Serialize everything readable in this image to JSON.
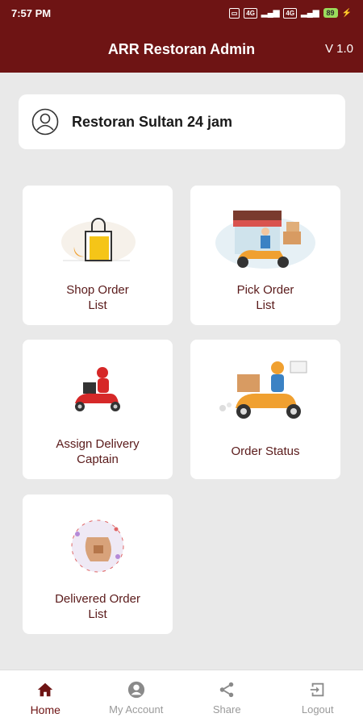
{
  "status_bar": {
    "time": "7:57 PM",
    "battery": "89"
  },
  "app_bar": {
    "title": "ARR Restoran Admin",
    "version": "V 1.0"
  },
  "restaurant": {
    "name": "Restoran Sultan 24 jam",
    "icon": "user-circle-icon"
  },
  "tiles": [
    {
      "line1": "Shop Order",
      "line2": "List",
      "icon": "shopping-bag-illustration"
    },
    {
      "line1": "Pick Order",
      "line2": "List",
      "icon": "restaurant-pickup-illustration"
    },
    {
      "line1": "Assign Delivery",
      "line2": "Captain",
      "icon": "delivery-rider-illustration"
    },
    {
      "line1": "Order Status",
      "icon": "scooter-delivery-illustration"
    },
    {
      "line1": "Delivered Order",
      "line2": "List",
      "icon": "delivered-package-illustration"
    }
  ],
  "bottom_nav": [
    {
      "label": "Home",
      "icon": "home-icon",
      "active": true
    },
    {
      "label": "My Account",
      "icon": "account-icon",
      "active": false
    },
    {
      "label": "Share",
      "icon": "share-icon",
      "active": false
    },
    {
      "label": "Logout",
      "icon": "logout-icon",
      "active": false
    }
  ],
  "colors": {
    "primary": "#6e1414",
    "background": "#e9e9e9",
    "card": "#ffffff",
    "nav_inactive": "#9a9a9a"
  }
}
